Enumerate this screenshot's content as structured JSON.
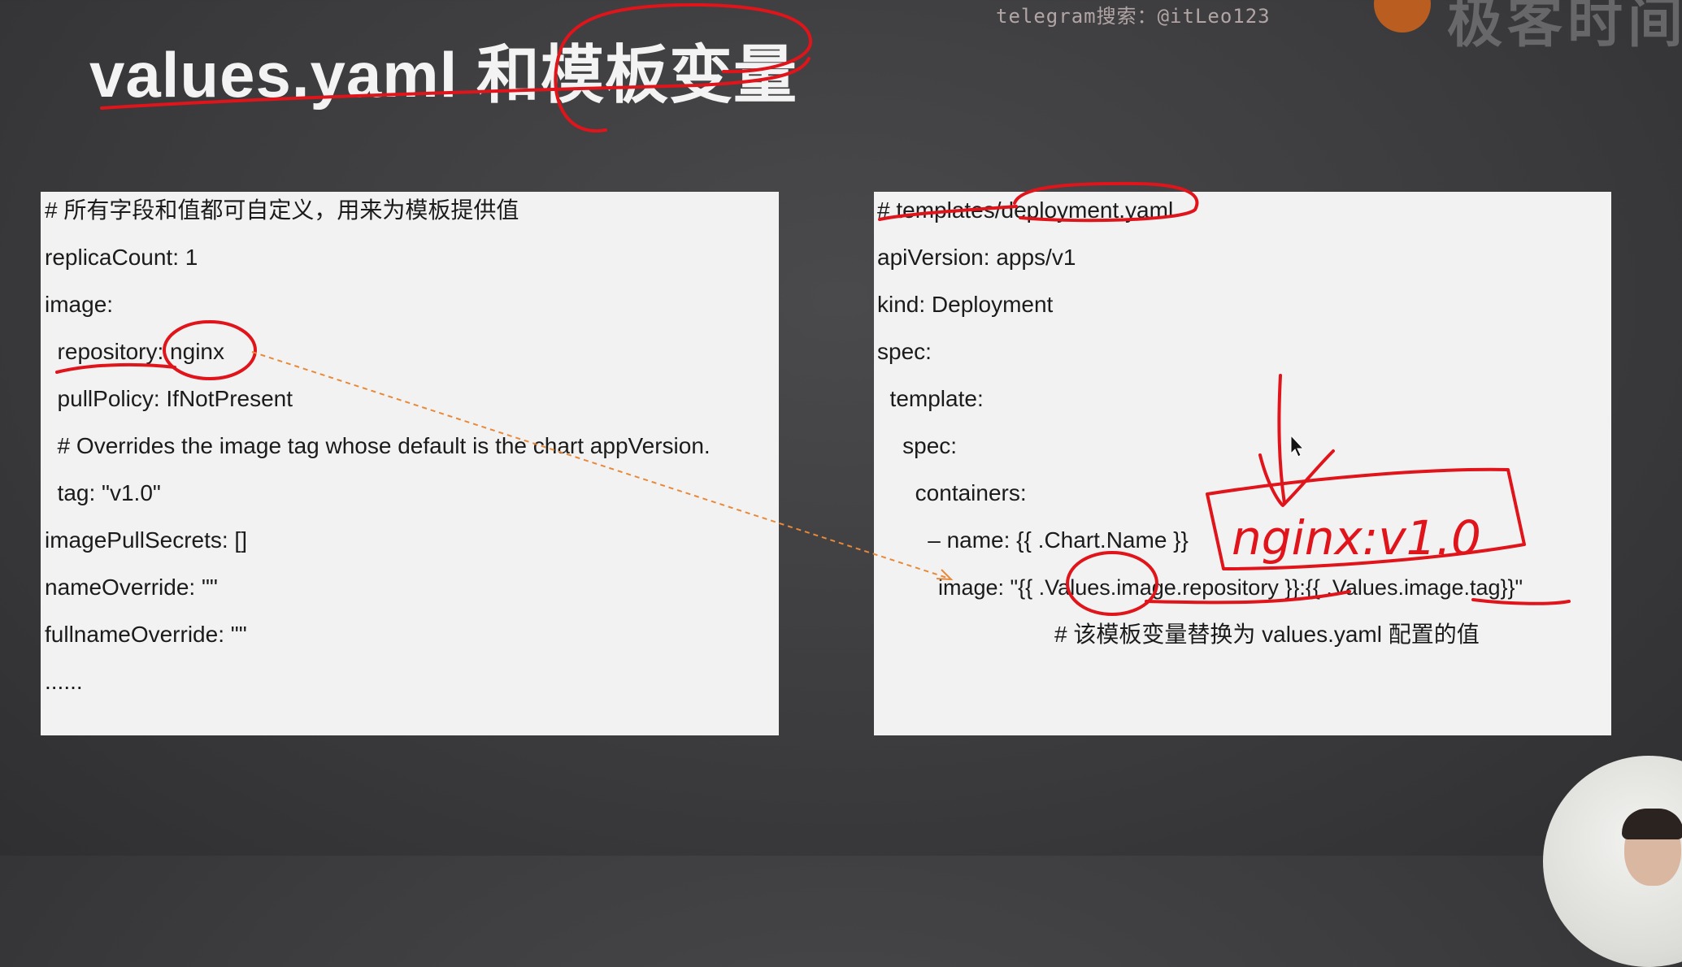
{
  "watermark": "telegram搜索：@itLeo123",
  "brand": {
    "text": "极客时间",
    "logo_icon": "brand-logo-icon"
  },
  "title": "values.yaml 和模板变量",
  "left_panel": {
    "lines": [
      "# 所有字段和值都可自定义，用来为模板提供值",
      "replicaCount: 1",
      "image:",
      "  repository: nginx",
      "  pullPolicy: IfNotPresent",
      "  # Overrides the image tag whose default is the chart appVersion.",
      "  tag: \"v1.0\"",
      "imagePullSecrets: []",
      "nameOverride: \"\"",
      "fullnameOverride: \"\"",
      "......"
    ]
  },
  "right_panel": {
    "lines": [
      "# templates/deployment.yaml",
      "apiVersion: apps/v1",
      "kind: Deployment",
      "spec:",
      "  template:",
      "    spec:",
      "      containers:",
      "        – name: {{ .Chart.Name }}",
      "          image: \"{{ .Values.image.repository }}:{{ .Values.image.tag}}\"",
      "# 该模板变量替换为 values.yaml 配置的值"
    ]
  },
  "annotations": {
    "handwritten_text": "nginx:v1.0",
    "pen_color": "#e0141b",
    "arrow_color": "#e8893a"
  }
}
